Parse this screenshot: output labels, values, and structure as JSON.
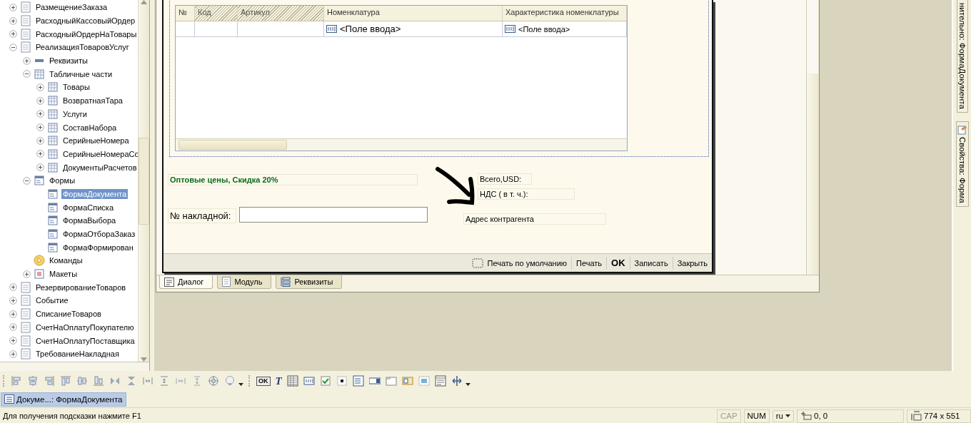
{
  "tree": {
    "items": [
      {
        "label": "РазмещениеЗаказа",
        "kind": "document",
        "expander": true,
        "expanded": false,
        "selected": false
      },
      {
        "label": "РасходныйКассовыйОрдер",
        "kind": "document",
        "expander": true,
        "expanded": false,
        "selected": false
      },
      {
        "label": "РасходныйОрдерНаТовары",
        "kind": "document",
        "expander": true,
        "expanded": false,
        "selected": false
      },
      {
        "label": "РеализацияТоваровУслуг",
        "kind": "document",
        "expander": true,
        "expanded": true,
        "selected": false,
        "children": [
          {
            "label": "Реквизиты",
            "kind": "attributes",
            "expander": true,
            "expanded": false,
            "selected": false
          },
          {
            "label": "Табличные части",
            "kind": "table",
            "expander": true,
            "expanded": true,
            "selected": false,
            "children": [
              {
                "label": "Товары",
                "kind": "table",
                "expander": true,
                "expanded": false,
                "selected": false
              },
              {
                "label": "ВозвратнаяТара",
                "kind": "table",
                "expander": true,
                "expanded": false,
                "selected": false
              },
              {
                "label": "Услуги",
                "kind": "table",
                "expander": true,
                "expanded": false,
                "selected": false
              },
              {
                "label": "СоставНабора",
                "kind": "table",
                "expander": true,
                "expanded": false,
                "selected": false
              },
              {
                "label": "СерийныеНомера",
                "kind": "table",
                "expander": true,
                "expanded": false,
                "selected": false
              },
              {
                "label": "СерийныеНомераСо",
                "kind": "table",
                "expander": true,
                "expanded": false,
                "selected": false
              },
              {
                "label": "ДокументыРасчетов",
                "kind": "table",
                "expander": true,
                "expanded": false,
                "selected": false
              }
            ]
          },
          {
            "label": "Формы",
            "kind": "forms",
            "expander": true,
            "expanded": true,
            "selected": false,
            "children": [
              {
                "label": "ФормаДокумента",
                "kind": "form",
                "expander": false,
                "selected": true
              },
              {
                "label": "ФормаСписка",
                "kind": "form",
                "expander": false,
                "selected": false
              },
              {
                "label": "ФормаВыбора",
                "kind": "form",
                "expander": false,
                "selected": false
              },
              {
                "label": "ФормаОтбораЗаказ",
                "kind": "form",
                "expander": false,
                "selected": false
              },
              {
                "label": "ФормаФормирован",
                "kind": "form",
                "expander": false,
                "selected": false
              }
            ]
          },
          {
            "label": "Команды",
            "kind": "commands",
            "expander": false,
            "selected": false
          },
          {
            "label": "Макеты",
            "kind": "templates",
            "expander": true,
            "expanded": false,
            "selected": false
          }
        ]
      },
      {
        "label": "РезервированиеТоваров",
        "kind": "document",
        "expander": true,
        "expanded": false,
        "selected": false
      },
      {
        "label": "Событие",
        "kind": "document",
        "expander": true,
        "expanded": false,
        "selected": false
      },
      {
        "label": "СписаниеТоваров",
        "kind": "document",
        "expander": true,
        "expanded": false,
        "selected": false
      },
      {
        "label": "СчетНаОплатуПокупателю",
        "kind": "document",
        "expander": true,
        "expanded": false,
        "selected": false
      },
      {
        "label": "СчетНаОплатуПоставщика",
        "kind": "document",
        "expander": true,
        "expanded": false,
        "selected": false
      },
      {
        "label": "ТребованиеНакладная",
        "kind": "document",
        "expander": true,
        "expanded": false,
        "selected": false
      }
    ]
  },
  "form": {
    "table": {
      "columns": [
        {
          "label": "№",
          "disabled": false
        },
        {
          "label": "Код",
          "disabled": true
        },
        {
          "label": "Артикул",
          "disabled": true
        },
        {
          "label": "Номенклатура",
          "disabled": false
        },
        {
          "label": "Характеристика номенклатуры",
          "disabled": false
        }
      ],
      "row": [
        {
          "value": "<Поле ввода>",
          "large": true
        },
        {
          "value": "<Поле ввода>",
          "large": false
        }
      ]
    },
    "price_label": "Оптовые цены, Скидка 20%",
    "total_label": "Всего,USD:",
    "vat_label": "НДС ( в т. ч.):",
    "invoice_label": "№ накладной:",
    "address_label": "Адрес контрагента",
    "commands": [
      {
        "label": "Печать по умолчанию",
        "kind": "icon"
      },
      {
        "label": "Печать",
        "kind": "plain"
      },
      {
        "label": "OK",
        "kind": "default"
      },
      {
        "label": "Записать",
        "kind": "plain"
      },
      {
        "label": "Закрыть",
        "kind": "plain"
      }
    ]
  },
  "designer_tabs": [
    {
      "label": "Диалог",
      "kind": "dialog",
      "selected": true
    },
    {
      "label": "Модуль",
      "kind": "module",
      "selected": false
    },
    {
      "label": "Реквизиты",
      "kind": "attributes",
      "selected": false
    }
  ],
  "side_tabs": [
    {
      "label": "нительно: ФормаДокумента",
      "kind": "plain"
    },
    {
      "label": "Свойства: Форма",
      "kind": "properties"
    }
  ],
  "palette": {
    "button_glyph": "OK",
    "label_glyph": "T"
  },
  "window_tabs": [
    {
      "label": "Докуме...: ФормаДокумента",
      "selected": true
    }
  ],
  "status_bar": {
    "hint": "Для получения подсказки нажмите F1",
    "indicators": [
      {
        "label": "CAP",
        "active": false
      },
      {
        "label": "NUM",
        "active": true
      }
    ],
    "language": "ru",
    "position": "0, 0",
    "size": "774 x 551"
  }
}
